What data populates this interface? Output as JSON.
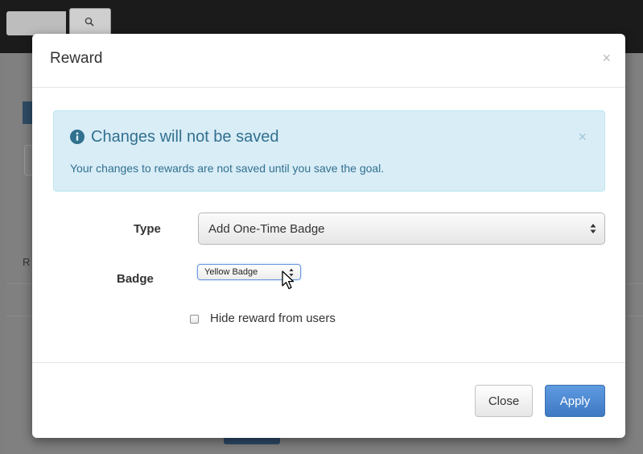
{
  "modal": {
    "title": "Reward",
    "close_glyph": "×"
  },
  "alert": {
    "icon": "info-circle-icon",
    "title": "Changes will not be saved",
    "message": "Your changes to rewards are not saved until you save the goal.",
    "close_glyph": "×"
  },
  "form": {
    "type_label": "Type",
    "type_value": "Add One-Time Badge",
    "badge_label": "Badge",
    "badge_value": "Yellow Badge",
    "hide_label": "Hide reward from users",
    "hide_checked": false
  },
  "footer": {
    "close_label": "Close",
    "apply_label": "Apply"
  },
  "background": {
    "partial_label": "R"
  },
  "colors": {
    "alert_bg": "#d9edf7",
    "alert_text": "#31708f",
    "primary": "#428bca"
  }
}
